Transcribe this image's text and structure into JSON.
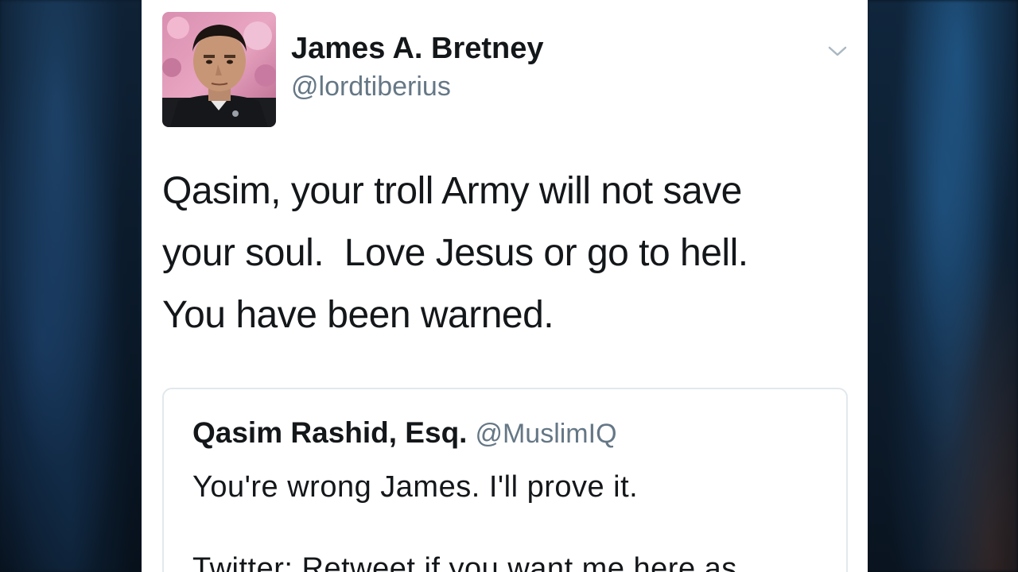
{
  "tweet": {
    "author": {
      "display_name": "James A. Bretney",
      "handle": "@lordtiberius"
    },
    "text_lines": [
      "Qasim, your troll Army will not save",
      "your soul.  Love Jesus or go to hell.",
      "You have been warned."
    ],
    "menu_icon": "chevron-down-icon"
  },
  "quoted_tweet": {
    "author": {
      "display_name": "Qasim Rashid, Esq.",
      "handle": "@MuslimIQ"
    },
    "text_lines": [
      "You're wrong James. I'll prove it.",
      "Twitter: Retweet if you want me here as"
    ]
  },
  "colors": {
    "primary_text": "#14171a",
    "secondary_text": "#657786",
    "border": "#e1e8ed",
    "card_background": "#ffffff"
  }
}
